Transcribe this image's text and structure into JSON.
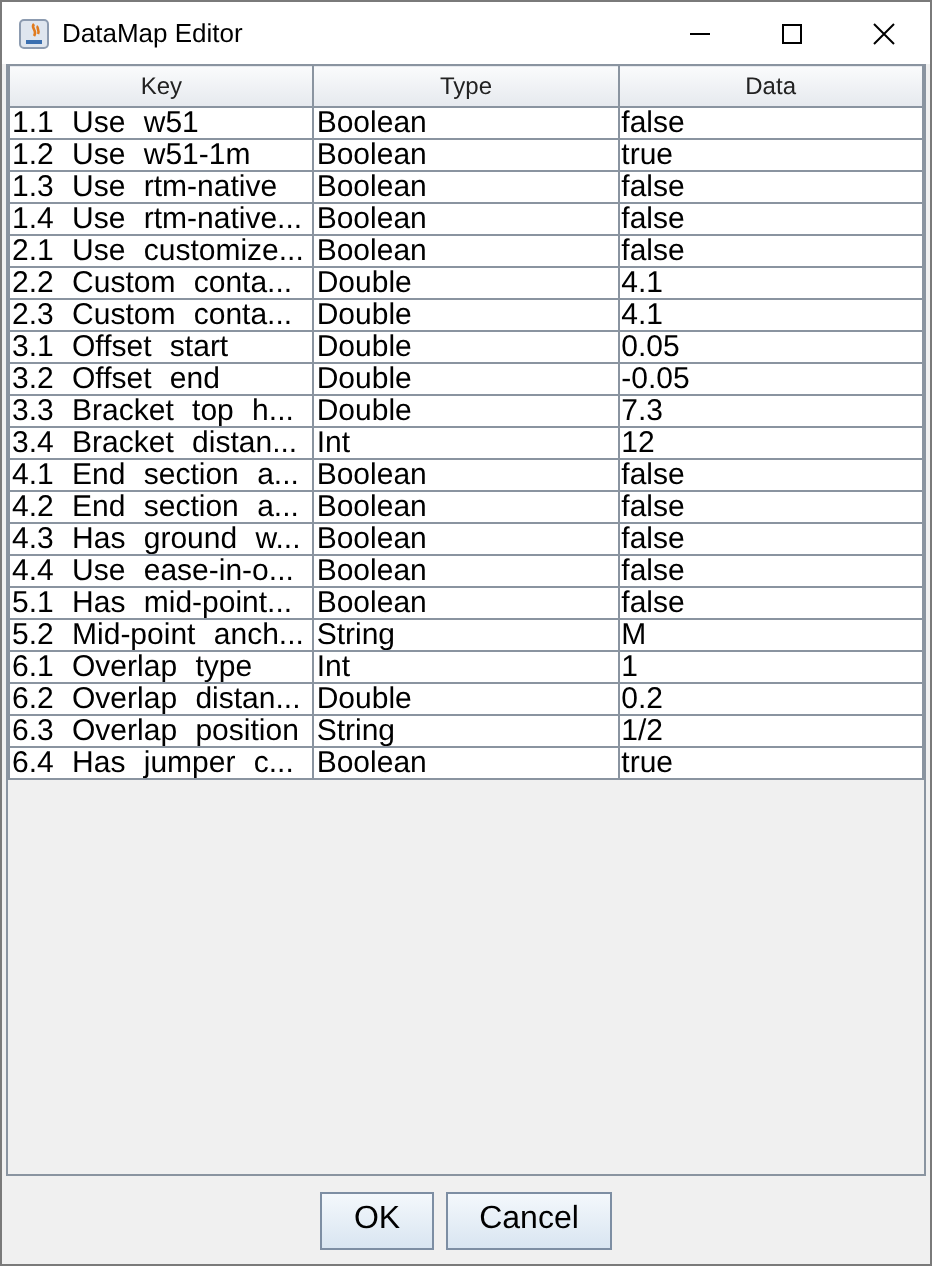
{
  "window": {
    "title": "DataMap Editor"
  },
  "table": {
    "columns": [
      "Key",
      "Type",
      "Data"
    ],
    "rows": [
      [
        "1.1 Use w51",
        "Boolean",
        "false"
      ],
      [
        "1.2 Use w51-1m",
        "Boolean",
        "true"
      ],
      [
        "1.3 Use rtm-native",
        "Boolean",
        "false"
      ],
      [
        "1.4 Use rtm-native...",
        "Boolean",
        "false"
      ],
      [
        "2.1 Use customize...",
        "Boolean",
        "false"
      ],
      [
        "2.2 Custom conta...",
        "Double",
        "4.1"
      ],
      [
        "2.3 Custom conta...",
        "Double",
        "4.1"
      ],
      [
        "3.1 Offset start",
        "Double",
        "0.05"
      ],
      [
        "3.2 Offset end",
        "Double",
        "-0.05"
      ],
      [
        "3.3 Bracket top h...",
        "Double",
        "7.3"
      ],
      [
        "3.4 Bracket distan...",
        "Int",
        "12"
      ],
      [
        "4.1 End section a...",
        "Boolean",
        "false"
      ],
      [
        "4.2 End section a...",
        "Boolean",
        "false"
      ],
      [
        "4.3 Has ground w...",
        "Boolean",
        "false"
      ],
      [
        "4.4 Use ease-in-o...",
        "Boolean",
        "false"
      ],
      [
        "5.1 Has mid-point...",
        "Boolean",
        "false"
      ],
      [
        "5.2 Mid-point anch...",
        "String",
        "M"
      ],
      [
        "6.1 Overlap type",
        "Int",
        "1"
      ],
      [
        "6.2 Overlap distan...",
        "Double",
        "0.2"
      ],
      [
        "6.3 Overlap position",
        "String",
        "1/2"
      ],
      [
        "6.4 Has jumper c...",
        "Boolean",
        "true"
      ]
    ]
  },
  "buttons": [
    "OK",
    "Cancel"
  ]
}
